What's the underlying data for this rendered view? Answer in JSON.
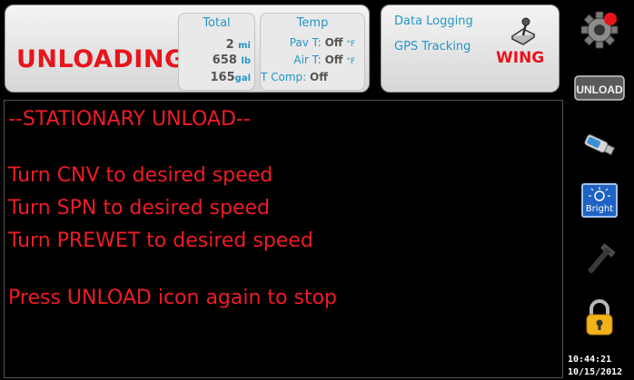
{
  "status": {
    "mode": "UNLOADING"
  },
  "totals": {
    "title": "Total",
    "distance_value": "2",
    "distance_unit": "mi",
    "weight_value": "658",
    "weight_unit": "lb",
    "volume_value": "165",
    "volume_unit": "gal"
  },
  "temp": {
    "title": "Temp",
    "pav_label": "Pav T:",
    "pav_value": "Off",
    "pav_unit": "°F",
    "air_label": "Air T:",
    "air_value": "Off",
    "air_unit": "°F",
    "comp_label": "T Comp:",
    "comp_value": "Off"
  },
  "right_panel": {
    "data_logging": "Data Logging",
    "gps_tracking": "GPS Tracking",
    "wing": "WING",
    "joystick_icon": "joystick-icon"
  },
  "main": {
    "title": "--STATIONARY UNLOAD--",
    "lines": [
      "Turn CNV to desired speed",
      "Turn SPN to desired speed",
      "Turn PREWET to desired speed",
      "Press UNLOAD icon again to stop"
    ]
  },
  "sidebar": {
    "icons": [
      "gear-icon",
      "unload-icon",
      "usb-icon",
      "brightness-icon",
      "wrench-icon",
      "lock-icon"
    ],
    "unload_label": "UNLOAD",
    "bright_label": "Bright"
  },
  "clock": {
    "time": "10:44:21",
    "date": "10/15/2012"
  },
  "colors": {
    "accent_red": "#e8141c",
    "accent_blue": "#2595c7",
    "background": "#000000"
  }
}
